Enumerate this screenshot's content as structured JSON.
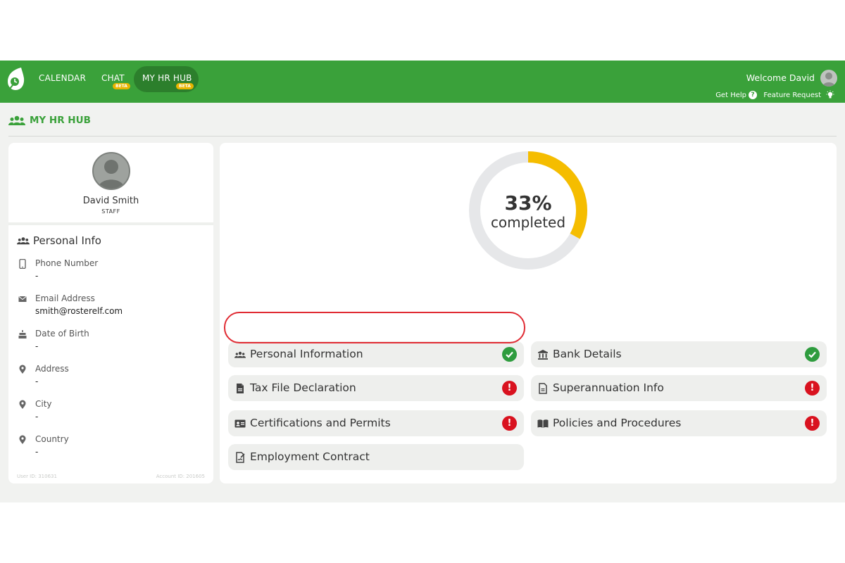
{
  "nav": {
    "calendar": "CALENDAR",
    "chat": "CHAT",
    "chat_badge": "BETA",
    "hr_hub": "MY HR HUB",
    "hr_hub_badge": "BETA"
  },
  "header": {
    "welcome": "Welcome David",
    "get_help": "Get Help",
    "feature_request": "Feature Request"
  },
  "page": {
    "title": "MY HR HUB"
  },
  "profile": {
    "name": "David Smith",
    "role": "STAFF"
  },
  "personal_info": {
    "heading": "Personal Info",
    "fields": [
      {
        "icon": "phone-icon",
        "label": "Phone Number",
        "value": "-"
      },
      {
        "icon": "mail-icon",
        "label": "Email Address",
        "value": "smith@rosterelf.com"
      },
      {
        "icon": "cake-icon",
        "label": "Date of Birth",
        "value": "-"
      },
      {
        "icon": "location-pin-icon",
        "label": "Address",
        "value": "-"
      },
      {
        "icon": "location-pin-icon",
        "label": "City",
        "value": "-"
      },
      {
        "icon": "location-pin-icon",
        "label": "Country",
        "value": "-"
      }
    ],
    "user_id": "User ID: 310631",
    "account_id": "Account ID: 201605"
  },
  "progress": {
    "percent_text": "33%",
    "caption": "completed",
    "fraction": 0.33,
    "track_color": "#e6e7e9",
    "fill_color": "#f5bd00"
  },
  "tiles": [
    {
      "label": "Personal Information",
      "icon": "users-icon",
      "status": "complete"
    },
    {
      "label": "Bank Details",
      "icon": "bank-icon",
      "status": "complete"
    },
    {
      "label": "Tax File Declaration",
      "icon": "document-icon",
      "status": "incomplete"
    },
    {
      "label": "Superannuation Info",
      "icon": "document-lines-icon",
      "status": "incomplete"
    },
    {
      "label": "Certifications and Permits",
      "icon": "id-card-icon",
      "status": "incomplete"
    },
    {
      "label": "Policies and Procedures",
      "icon": "book-icon",
      "status": "incomplete"
    },
    {
      "label": "Employment Contract",
      "icon": "contract-icon",
      "status": "none"
    }
  ],
  "colors": {
    "brand_green": "#3aa13a",
    "dark_green": "#2c7f2c",
    "beta_yellow": "#e8b400",
    "ok_green": "#2e9c3e",
    "alert_red": "#d9121f",
    "highlight_red": "#e02b33"
  }
}
